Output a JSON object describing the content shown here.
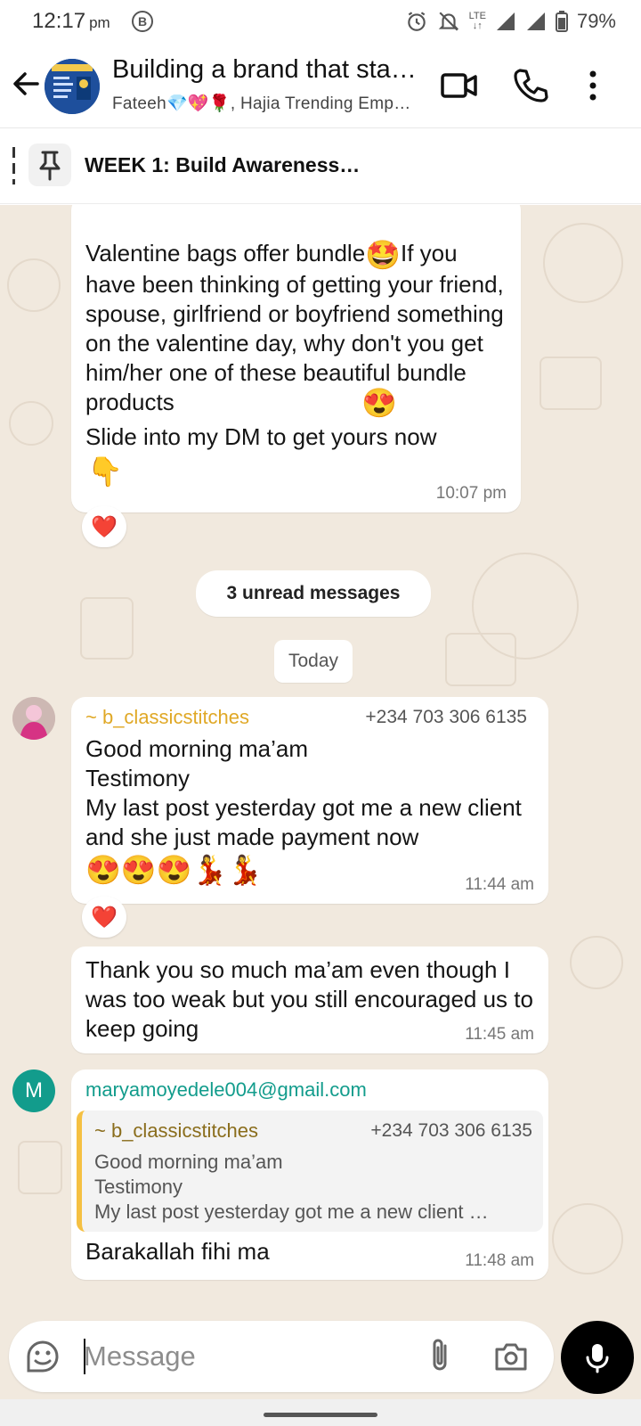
{
  "status_bar": {
    "time": "12:17",
    "ampm": "pm",
    "b_badge": "B",
    "network": "LTE",
    "battery": "79%"
  },
  "header": {
    "title": "Building a brand that sta…",
    "members": "Fateeh💎💖🌹, Hajia Trending Emp…",
    "avatar_text": "HANDS OUT CHALLENGE"
  },
  "pinned": {
    "text": "WEEK 1: Build Awareness…"
  },
  "messages": {
    "m1": {
      "line1": " Valentine bags offer bundle",
      "emoji1": "🤩",
      "line1b": "If you",
      "body": "have been thinking of getting your friend, spouse, girlfriend or boyfriend something on the valentine day, why don't you get him/her  one of these beautiful bundle products",
      "emoji2": "😍",
      "line3": "   Slide into my DM to get yours now",
      "emoji3": "👇",
      "time": "10:07 pm",
      "reaction": "❤️"
    },
    "unread": "3 unread messages",
    "date_divider": "Today",
    "m2": {
      "sender": "~ b_classicstitches",
      "phone": "+234 703 306 6135",
      "text_l1": "Good morning ma’am",
      "text_l2": "Testimony",
      "text_l3": "My last post yesterday got me a new client and she just made payment now",
      "emojis": "😍😍😍💃💃",
      "time": "11:44 am",
      "reaction": "❤️"
    },
    "m3": {
      "text": "Thank you so much ma’am even though I was too weak but you still encouraged us to keep going",
      "time": "11:45 am"
    },
    "m4": {
      "avatar_letter": "M",
      "sender": "maryamoyedele004@gmail.com",
      "quote_sender": "~ b_classicstitches",
      "quote_phone": "+234 703 306 6135",
      "quote_l1": "Good morning ma’am",
      "quote_l2": "Testimony",
      "quote_l3": "My last post yesterday got me a new client …",
      "text": "Barakallah fihi ma",
      "time": "11:48 am"
    }
  },
  "input": {
    "placeholder": "Message"
  },
  "colors": {
    "chat_bg": "#f1e9de",
    "sender_yellow": "#e0a826",
    "sender_teal": "#129c8c",
    "quote_accent": "#f5c042",
    "quote_name": "#8a6d1c"
  }
}
